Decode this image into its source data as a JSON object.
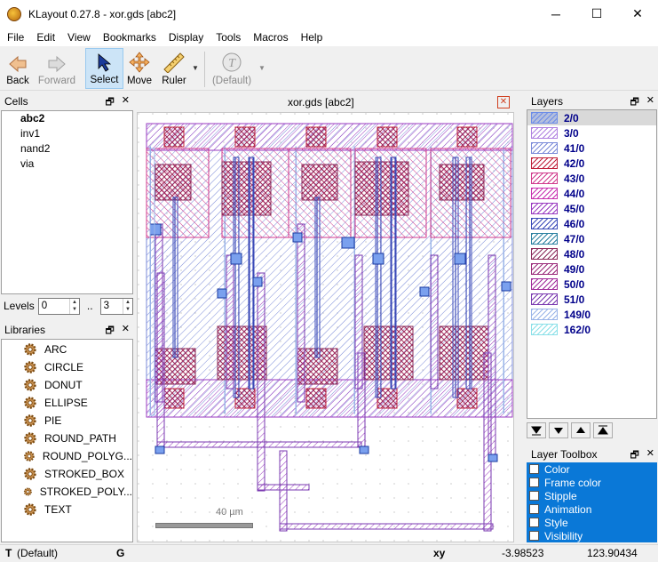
{
  "window": {
    "title": "KLayout 0.27.8 - xor.gds [abc2]",
    "minimize": "─",
    "maximize": "☐",
    "close": "✕"
  },
  "menu": [
    "File",
    "Edit",
    "View",
    "Bookmarks",
    "Display",
    "Tools",
    "Macros",
    "Help"
  ],
  "toolbar": {
    "back": "Back",
    "forward": "Forward",
    "select": "Select",
    "move": "Move",
    "ruler": "Ruler",
    "default": "(Default)"
  },
  "cells": {
    "title": "Cells",
    "items": [
      "abc2",
      "inv1",
      "nand2",
      "via"
    ]
  },
  "levels": {
    "label": "Levels",
    "from": "0",
    "sep": "..",
    "to": "3"
  },
  "libraries": {
    "title": "Libraries",
    "items": [
      "ARC",
      "CIRCLE",
      "DONUT",
      "ELLIPSE",
      "PIE",
      "ROUND_PATH",
      "ROUND_POLYG...",
      "STROKED_BOX",
      "STROKED_POLY...",
      "TEXT"
    ]
  },
  "document": {
    "tab_title": "xor.gds [abc2]",
    "scale_label": "40  µm"
  },
  "layers": {
    "title": "Layers",
    "items": [
      {
        "name": "2/0",
        "color": "#6c8ce8"
      },
      {
        "name": "3/0",
        "color": "#b080e0"
      },
      {
        "name": "41/0",
        "color": "#7a8ad8"
      },
      {
        "name": "42/0",
        "color": "#c0203a"
      },
      {
        "name": "43/0",
        "color": "#d03a8c"
      },
      {
        "name": "44/0",
        "color": "#c830b0"
      },
      {
        "name": "45/0",
        "color": "#9a3ac0"
      },
      {
        "name": "46/0",
        "color": "#3a4ab8"
      },
      {
        "name": "47/0",
        "color": "#2a80a0"
      },
      {
        "name": "48/0",
        "color": "#8a2a5a"
      },
      {
        "name": "49/0",
        "color": "#9a2a7a"
      },
      {
        "name": "50/0",
        "color": "#a02a9a"
      },
      {
        "name": "51/0",
        "color": "#7a3ab0"
      },
      {
        "name": "149/0",
        "color": "#9ab4e8"
      },
      {
        "name": "162/0",
        "color": "#8ae0e8"
      }
    ]
  },
  "layer_toolbox": {
    "title": "Layer Toolbox",
    "items": [
      "Color",
      "Frame color",
      "Stipple",
      "Animation",
      "Style",
      "Visibility"
    ]
  },
  "status": {
    "t": "T",
    "mode": "(Default)",
    "g": "G",
    "xy": "xy",
    "x": "-3.98523",
    "y": "123.90434"
  }
}
